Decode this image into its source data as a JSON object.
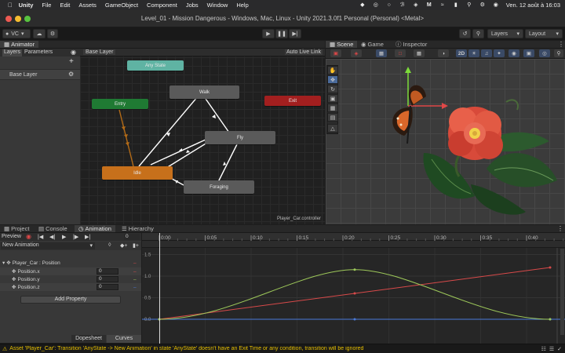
{
  "menubar": {
    "apple_icon": "apple-icon",
    "app": "Unity",
    "items": [
      "File",
      "Edit",
      "Assets",
      "GameObject",
      "Component",
      "Jobs",
      "Window",
      "Help"
    ],
    "datetime": "Ven. 12 août à 16:03"
  },
  "window": {
    "title": "Level_01 - Mission Dangerous - Windows, Mac, Linux - Unity 2021.3.0f1 Personal (Personal) <Metal>"
  },
  "toolbar": {
    "account": "VC",
    "layers": "Layers",
    "layout": "Layout"
  },
  "animator": {
    "tab": "Animator",
    "subtabs": [
      "Layers",
      "Parameters"
    ],
    "breadcrumb": "Base Layer",
    "auto_live_link": "Auto Live Link",
    "layer_name": "Base Layer",
    "controller": "Player_Car.controller",
    "states": {
      "any": "Any State",
      "entry": "Entry",
      "exit": "Exit",
      "walk": "Walk",
      "fly": "Fly",
      "idle": "Idle",
      "foraging": "Foraging"
    },
    "colors": {
      "any": "#5fb3a3",
      "entry": "#1f7a33",
      "exit": "#a31f1f",
      "state": "#5a5a5a",
      "idle": "#c7701b"
    }
  },
  "scene": {
    "tabs": [
      "Scene",
      "Game",
      "Inspector"
    ],
    "mode_2d": "2D"
  },
  "bottom": {
    "tabs": [
      "Project",
      "Console",
      "Animation",
      "Hierarchy"
    ],
    "preview": "Preview",
    "frame": "0",
    "clip": "New Animation",
    "property_group": "Player_Car : Position",
    "properties": [
      {
        "name": "Position.x",
        "value": "0"
      },
      {
        "name": "Position.y",
        "value": "0"
      },
      {
        "name": "Position.z",
        "value": "0"
      }
    ],
    "add_property": "Add Property",
    "dopesheet": "Dopesheet",
    "curves": "Curves",
    "timeline": [
      "0:00",
      "0:05",
      "0:10",
      "0:15",
      "0:20",
      "0:25",
      "0:30",
      "0:35",
      "0:40"
    ],
    "y_axis": [
      "1.5",
      "1.0",
      "0.5",
      "0.0"
    ],
    "curve_colors": {
      "x": "#d94a4a",
      "y": "#9ec95a",
      "z": "#4a7ad9"
    }
  },
  "status": {
    "message": "Asset 'Player_Car': Transition 'AnyState -> New Animation' in state 'AnyState' doesn't have an Exit Time or any condition, transition will be ignored"
  }
}
